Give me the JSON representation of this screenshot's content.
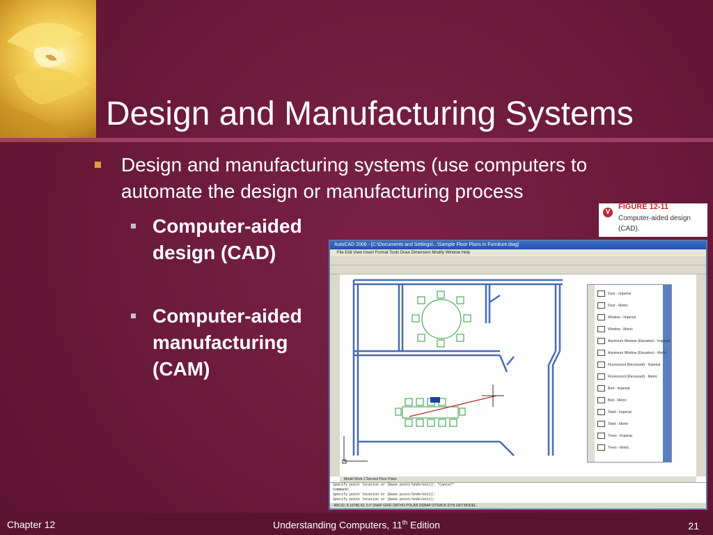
{
  "slide": {
    "title": "Design and Manufacturing Systems",
    "bullet": "Design and manufacturing systems (use computers to automate the design or manufacturing process",
    "sub_items": [
      {
        "label": "Computer-aided design (CAD)"
      },
      {
        "label": "Computer-aided manufacturing (CAM)"
      }
    ]
  },
  "figure": {
    "badge": "V",
    "number": "FIGURE 12-11",
    "caption": "Computer-aided design (CAD).",
    "app_title": "AutoCAD 2006 - [C:\\Documents and Settings\\...\\Sample Floor Plans in Furniture.dwg]",
    "menu": "File  Edit  View  Insert  Format  Tools  Draw  Dimension  Modify  Window  Help",
    "palette_items": [
      "Door - Imperial",
      "Door - Metric",
      "Window - Imperial",
      "Window - Metric",
      "Aluminum Window (Elevation) - Imperial",
      "Aluminum Window (Elevation) - Metric",
      "Fluorescent (Recessed) - Imperial",
      "Fluorescent (Recessed) - Metric",
      "Bed - Imperial",
      "Bed - Metric",
      "Toilet - Imperial",
      "Toilet - Metric",
      "Trees - Imperial",
      "Trees - Metric"
    ],
    "tabs": "Model  Work 2 Second Floor Plans",
    "cmd_lines": [
      "Specify point location or [Base point/Undo/eXit]: *Cancel*",
      "Command:",
      "Specify point location or [Base point/Undo/eXit]:",
      "Specify point location or [Base point/Undo/eXit]:"
    ],
    "status": "-466.92, 8-16786.42, 0.0'   SNAP  GRID  ORTHO  POLAR  OSNAP  OTRACK  DYN  LWT  MODEL"
  },
  "footer": {
    "chapter": "Chapter 12",
    "book": "Understanding Computers, 11",
    "book_sup": "th",
    "book_tail": " Edition",
    "page": "21"
  },
  "colors": {
    "background": "#6e1c3c",
    "bullet_marker": "#d9a13a",
    "figure_accent": "#c0282f"
  }
}
